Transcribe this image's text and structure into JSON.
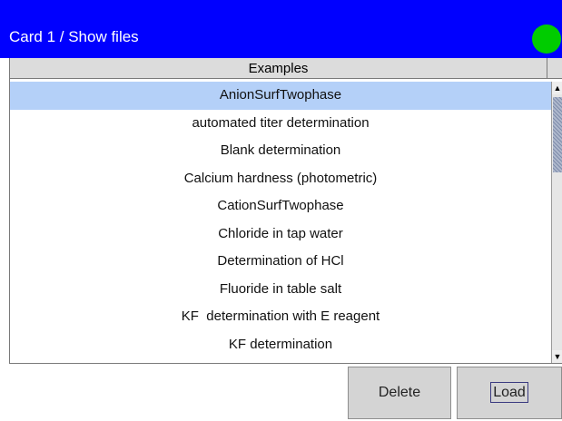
{
  "titlebar": {
    "title": "Card 1 / Show files",
    "status_color": "#00cc00"
  },
  "file_list": {
    "header": "Examples",
    "items": [
      "AnionSurfTwophase",
      "automated titer determination",
      "Blank determination",
      "Calcium hardness (photometric)",
      "CationSurfTwophase",
      "Chloride in tap water",
      "Determination of HCl",
      "Fluoride in table salt",
      "KF  determination with E reagent",
      "KF determination"
    ],
    "selected_index": 0
  },
  "scrollbar": {
    "up_icon": "arrow-up-icon",
    "down_icon": "arrow-down-icon"
  },
  "buttons": {
    "delete_label": "Delete",
    "load_label": "Load"
  }
}
